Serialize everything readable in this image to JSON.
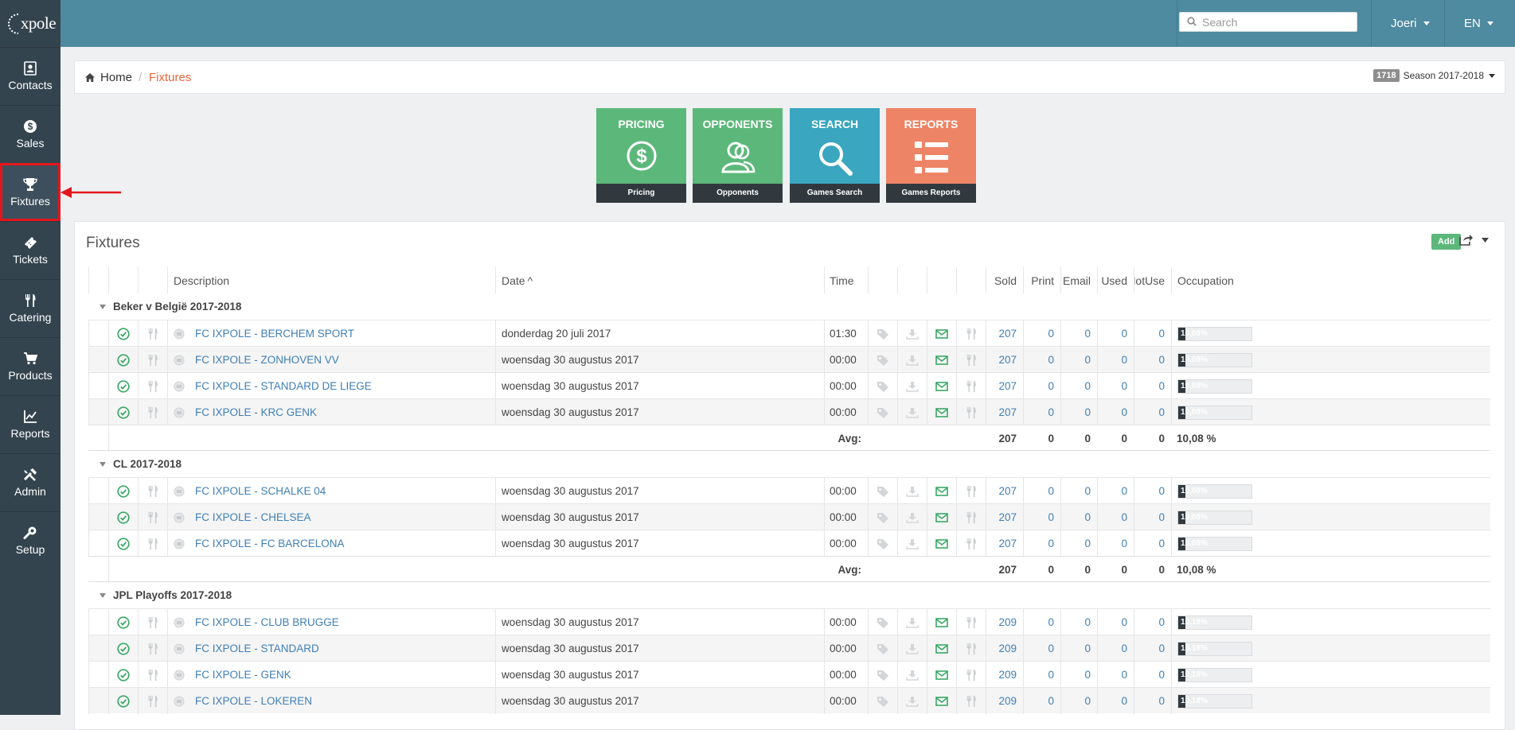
{
  "app": {
    "logo_text": "xpole"
  },
  "sidebar": {
    "items": [
      {
        "label": "Contacts",
        "icon": "contacts-icon"
      },
      {
        "label": "Sales",
        "icon": "dollar-icon"
      },
      {
        "label": "Fixtures",
        "icon": "trophy-icon",
        "active": true
      },
      {
        "label": "Tickets",
        "icon": "ticket-icon"
      },
      {
        "label": "Catering",
        "icon": "cutlery-icon"
      },
      {
        "label": "Products",
        "icon": "cart-icon"
      },
      {
        "label": "Reports",
        "icon": "chart-icon"
      },
      {
        "label": "Admin",
        "icon": "tools-icon"
      },
      {
        "label": "Setup",
        "icon": "wrench-icon"
      }
    ]
  },
  "topbar": {
    "search_placeholder": "Search",
    "user": "Joeri",
    "language": "EN"
  },
  "breadcrumb": {
    "home": "Home",
    "separator": "/",
    "current": "Fixtures",
    "season_badge": "1718",
    "season_label": "Season 2017-2018"
  },
  "tiles": [
    {
      "title": "PRICING",
      "footer": "Pricing",
      "color": "#5cb87a",
      "icon": "dollar-circle-icon"
    },
    {
      "title": "OPPONENTS",
      "footer": "Opponents",
      "color": "#5cb87a",
      "icon": "users-icon"
    },
    {
      "title": "SEARCH",
      "footer": "Games Search",
      "color": "#3aa6c0",
      "icon": "search-icon"
    },
    {
      "title": "REPORTS",
      "footer": "Games Reports",
      "color": "#ee8466",
      "icon": "list-icon"
    }
  ],
  "panel": {
    "title": "Fixtures",
    "add_label": "Add"
  },
  "table": {
    "headers": {
      "description": "Description",
      "date": "Date",
      "time": "Time",
      "sold": "Sold",
      "print": "Print",
      "email": "Email",
      "used": "Used",
      "notuse": "NotUse",
      "occupation": "Occupation"
    },
    "sort_indicator": "^",
    "avg_label": "Avg:",
    "groups": [
      {
        "title": "Beker v België 2017-2018",
        "rows": [
          {
            "desc": "FC IXPOLE - BERCHEM SPORT",
            "date": "donderdag 20 juli 2017",
            "time": "01:30",
            "sold": "207",
            "print": "0",
            "email": "0",
            "used": "0",
            "notuse": "0",
            "occ_label": "10,08%",
            "occ": 0.1008
          },
          {
            "desc": "FC IXPOLE - ZONHOVEN VV",
            "date": "woensdag 30 augustus 2017",
            "time": "00:00",
            "sold": "207",
            "print": "0",
            "email": "0",
            "used": "0",
            "notuse": "0",
            "occ_label": "10,08%",
            "occ": 0.1008
          },
          {
            "desc": "FC IXPOLE - STANDARD DE LIEGE",
            "date": "woensdag 30 augustus 2017",
            "time": "00:00",
            "sold": "207",
            "print": "0",
            "email": "0",
            "used": "0",
            "notuse": "0",
            "occ_label": "10,08%",
            "occ": 0.1008
          },
          {
            "desc": "FC IXPOLE - KRC GENK",
            "date": "woensdag 30 augustus 2017",
            "time": "00:00",
            "sold": "207",
            "print": "0",
            "email": "0",
            "used": "0",
            "notuse": "0",
            "occ_label": "10,08%",
            "occ": 0.1008
          }
        ],
        "avg": {
          "sold": "207",
          "print": "0",
          "email": "0",
          "used": "0",
          "notuse": "0",
          "occupation": "10,08 %"
        }
      },
      {
        "title": "CL 2017-2018",
        "rows": [
          {
            "desc": "FC IXPOLE - SCHALKE 04",
            "date": "woensdag 30 augustus 2017",
            "time": "00:00",
            "sold": "207",
            "print": "0",
            "email": "0",
            "used": "0",
            "notuse": "0",
            "occ_label": "10,08%",
            "occ": 0.1008
          },
          {
            "desc": "FC IXPOLE - CHELSEA",
            "date": "woensdag 30 augustus 2017",
            "time": "00:00",
            "sold": "207",
            "print": "0",
            "email": "0",
            "used": "0",
            "notuse": "0",
            "occ_label": "10,08%",
            "occ": 0.1008
          },
          {
            "desc": "FC IXPOLE - FC BARCELONA",
            "date": "woensdag 30 augustus 2017",
            "time": "00:00",
            "sold": "207",
            "print": "0",
            "email": "0",
            "used": "0",
            "notuse": "0",
            "occ_label": "10,08%",
            "occ": 0.1008
          }
        ],
        "avg": {
          "sold": "207",
          "print": "0",
          "email": "0",
          "used": "0",
          "notuse": "0",
          "occupation": "10,08 %"
        }
      },
      {
        "title": "JPL Playoffs 2017-2018",
        "rows": [
          {
            "desc": "FC IXPOLE - CLUB BRUGGE",
            "date": "woensdag 30 augustus 2017",
            "time": "00:00",
            "sold": "209",
            "print": "0",
            "email": "0",
            "used": "0",
            "notuse": "0",
            "occ_label": "10,18%",
            "occ": 0.1018
          },
          {
            "desc": "FC IXPOLE - STANDARD",
            "date": "woensdag 30 augustus 2017",
            "time": "00:00",
            "sold": "209",
            "print": "0",
            "email": "0",
            "used": "0",
            "notuse": "0",
            "occ_label": "10,18%",
            "occ": 0.1018
          },
          {
            "desc": "FC IXPOLE - GENK",
            "date": "woensdag 30 augustus 2017",
            "time": "00:00",
            "sold": "209",
            "print": "0",
            "email": "0",
            "used": "0",
            "notuse": "0",
            "occ_label": "10,18%",
            "occ": 0.1018
          },
          {
            "desc": "FC IXPOLE - LOKEREN",
            "date": "woensdag 30 augustus 2017",
            "time": "00:00",
            "sold": "209",
            "print": "0",
            "email": "0",
            "used": "0",
            "notuse": "0",
            "occ_label": "10,18%",
            "occ": 0.1018
          }
        ]
      }
    ]
  },
  "colors": {
    "sidebar": "#34444f",
    "topbar": "#4e8aa0",
    "link": "#3f7fb5",
    "accent": "#e5673b",
    "highlight": "#e4161d"
  }
}
